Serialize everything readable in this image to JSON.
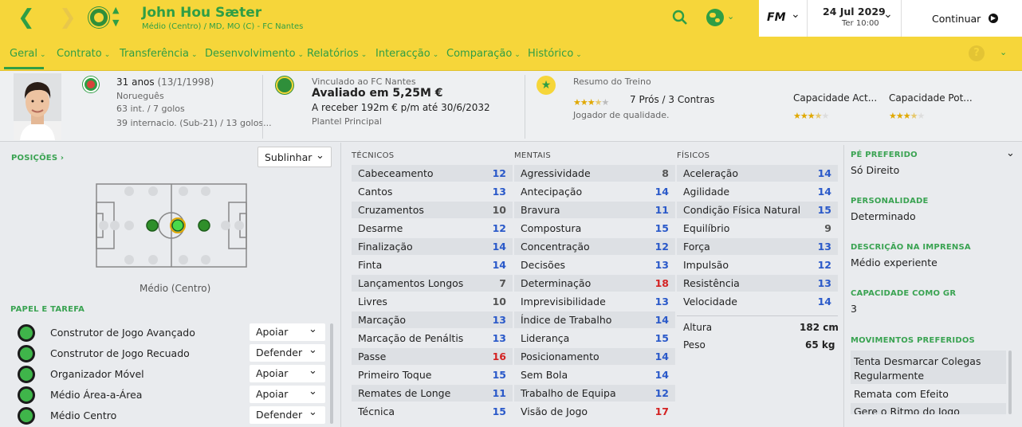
{
  "header": {
    "player_name": "John Hou Sæter",
    "player_sub": "Médio (Centro) / MD, MO (C) - FC Nantes",
    "date": "24 Jul 2029",
    "time": "Ter 10:00",
    "continue_label": "Continuar",
    "fm_label": "FM"
  },
  "tabs": [
    {
      "label": "Geral"
    },
    {
      "label": "Contrato"
    },
    {
      "label": "Transferência"
    },
    {
      "label": "Desenvolvimento"
    },
    {
      "label": "Relatórios"
    },
    {
      "label": "Interacção"
    },
    {
      "label": "Comparação"
    },
    {
      "label": "Histórico"
    }
  ],
  "info": {
    "age": "31 anos",
    "dob": "(13/1/1998)",
    "nationality": "Norueguês",
    "caps": "63 int. / 7 golos",
    "youth_caps": "39 internacio. (Sub-21) / 13 golos...",
    "club_line": "Vinculado ao FC Nantes",
    "value": "Avaliado em 5,25M €",
    "wage": "A receber 192m € p/m até 30/6/2032",
    "squad": "Plantel Principal",
    "training_title": "Resumo do Treino",
    "pros_cons": "7 Prós / 3 Contras",
    "quality": "Jogador de qualidade.",
    "cap_actual": "Capacidade Act...",
    "cap_potential": "Capacidade Pot...",
    "training_stars": 3.5,
    "cap_actual_stars": 3.5,
    "cap_potential_stars": 3.5
  },
  "positions": {
    "title": "POSIÇÕES ›",
    "highlight_label": "Sublinhar",
    "position_label": "Médio (Centro)"
  },
  "roles": {
    "title": "PAPEL E TAREFA",
    "items": [
      {
        "name": "Construtor de Jogo Avançado",
        "duty": "Apoiar"
      },
      {
        "name": "Construtor de Jogo Recuado",
        "duty": "Defender"
      },
      {
        "name": "Organizador Móvel",
        "duty": "Apoiar"
      },
      {
        "name": "Médio Área-a-Área",
        "duty": "Apoiar"
      },
      {
        "name": "Médio Centro",
        "duty": "Defender"
      }
    ]
  },
  "attributes": {
    "technical_title": "TÉCNICOS",
    "mental_title": "MENTAIS",
    "physical_title": "FÍSICOS",
    "technical": [
      {
        "name": "Cabeceamento",
        "value": "12"
      },
      {
        "name": "Cantos",
        "value": "13"
      },
      {
        "name": "Cruzamentos",
        "value": "10"
      },
      {
        "name": "Desarme",
        "value": "12"
      },
      {
        "name": "Finalização",
        "value": "14"
      },
      {
        "name": "Finta",
        "value": "14"
      },
      {
        "name": "Lançamentos Longos",
        "value": "7"
      },
      {
        "name": "Livres",
        "value": "10"
      },
      {
        "name": "Marcação",
        "value": "13"
      },
      {
        "name": "Marcação de Penáltis",
        "value": "13"
      },
      {
        "name": "Passe",
        "value": "16"
      },
      {
        "name": "Primeiro Toque",
        "value": "15"
      },
      {
        "name": "Remates de Longe",
        "value": "11"
      },
      {
        "name": "Técnica",
        "value": "15"
      }
    ],
    "mental": [
      {
        "name": "Agressividade",
        "value": "8"
      },
      {
        "name": "Antecipação",
        "value": "14"
      },
      {
        "name": "Bravura",
        "value": "11"
      },
      {
        "name": "Compostura",
        "value": "15"
      },
      {
        "name": "Concentração",
        "value": "12"
      },
      {
        "name": "Decisões",
        "value": "13"
      },
      {
        "name": "Determinação",
        "value": "18"
      },
      {
        "name": "Imprevisibilidade",
        "value": "13"
      },
      {
        "name": "Índice de Trabalho",
        "value": "14"
      },
      {
        "name": "Liderança",
        "value": "15"
      },
      {
        "name": "Posicionamento",
        "value": "14"
      },
      {
        "name": "Sem Bola",
        "value": "14"
      },
      {
        "name": "Trabalho de Equipa",
        "value": "12"
      },
      {
        "name": "Visão de Jogo",
        "value": "17"
      }
    ],
    "physical": [
      {
        "name": "Aceleração",
        "value": "14"
      },
      {
        "name": "Agilidade",
        "value": "14"
      },
      {
        "name": "Condição Física Natural",
        "value": "15"
      },
      {
        "name": "Equilíbrio",
        "value": "9"
      },
      {
        "name": "Força",
        "value": "13"
      },
      {
        "name": "Impulsão",
        "value": "12"
      },
      {
        "name": "Resistência",
        "value": "13"
      },
      {
        "name": "Velocidade",
        "value": "14"
      }
    ],
    "height_label": "Altura",
    "height_value": "182 cm",
    "weight_label": "Peso",
    "weight_value": "65 kg"
  },
  "right_panel": {
    "foot_title": "PÉ PREFERIDO",
    "foot_value": "Só Direito",
    "personality_title": "PERSONALIDADE",
    "personality_value": "Determinado",
    "press_title": "DESCRIÇÃO NA IMPRENSA",
    "press_value": "Médio experiente",
    "gk_title": "CAPACIDADE COMO GR",
    "gk_value": "3",
    "moves_title": "MOVIMENTOS PREFERIDOS",
    "moves": [
      "Tenta Desmarcar Colegas Regularmente",
      "Remata com Efeito",
      "Gere o Ritmo do Jogo"
    ]
  },
  "colors": {
    "accent_yellow": "#f6d63a",
    "accent_green": "#2f9e45",
    "value_blue": "#2a59c9",
    "value_red": "#d42222",
    "star_gold": "#e0a800"
  }
}
